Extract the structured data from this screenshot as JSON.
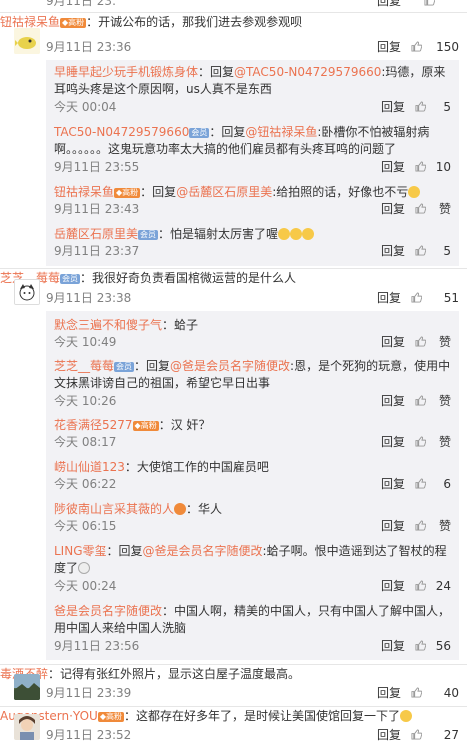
{
  "colors": {
    "name": "#eb7350",
    "vip": "#f08a3a",
    "member": "#7aa3d8",
    "reply_bg": "#f2f2f5"
  },
  "labels": {
    "reply": "回复",
    "like": "赞"
  },
  "top_cutoff": {
    "time": "9月11日 23:"
  },
  "threads": [
    {
      "author": "钮祜禄呆鱼",
      "text": "：开诚公布的话，那我们进去参观参观呗",
      "time": "9月11日 23:36",
      "likes": "150",
      "replies": [
        {
          "author": "早睡早起少玩手机锻炼身体",
          "body_pre": "：回复",
          "mention": "@TAC50-N04729579660",
          "body": ":玛德，原来耳鸣头疼是这个原因啊，us人真不是东西",
          "time": "今天 00:04",
          "likes": "5"
        },
        {
          "author": "TAC50-N04729579660",
          "body_pre": "：回复",
          "mention": "@钮祜禄呆鱼",
          "body": ":卧槽你不怕被辐射病啊。。。。。。这鬼玩意功率太大搞的他们雇员都有头疼耳鸣的问题了",
          "time": "9月11日 23:55",
          "likes": "10"
        },
        {
          "author": "钮祜禄呆鱼",
          "body_pre": "：回复",
          "mention": "@岳麓区石原里美",
          "body": ":给拍照的话，好像也不亏",
          "time": "9月11日 23:43",
          "likes": "赞"
        },
        {
          "author": "岳麓区石原里美",
          "body_pre": "：怕是辐射太厉害了喔",
          "mention": "",
          "body": "",
          "time": "9月11日 23:37",
          "likes": "5"
        }
      ]
    },
    {
      "author": "芝芝__莓莓",
      "text": "：我很好奇负责看国棺微运营的是什么人",
      "time": "9月11日 23:38",
      "likes": "51",
      "replies": [
        {
          "author": "默念三遍不和傻子气",
          "body_pre": "：蛤子",
          "mention": "",
          "body": "",
          "time": "今天 10:49",
          "likes": "赞"
        },
        {
          "author": "芝芝__莓莓",
          "body_pre": "：回复",
          "mention": "@爸是会员名字随便改",
          "body": ":恩，是个死狗的玩意，使用中文抹黑诽谤自己的祖国，希望它早日出事",
          "time": "今天 10:26",
          "likes": "赞"
        },
        {
          "author": "花香满径5277",
          "body_pre": "：汉 奸？",
          "mention": "",
          "body": "",
          "time": "今天 08:17",
          "likes": "赞"
        },
        {
          "author": "崂山仙道123",
          "body_pre": "：大使馆工作的中国雇员吧",
          "mention": "",
          "body": "",
          "time": "今天 06:22",
          "likes": "6"
        },
        {
          "author": "陟彼南山言采其薇的人",
          "body_pre": "：华人",
          "mention": "",
          "body": "",
          "time": "今天 06:15",
          "likes": "赞"
        },
        {
          "author": "LING零玺",
          "body_pre": "：回复",
          "mention": "@爸是会员名字随便改",
          "body": ":蛤子啊。恨中造谣到达了智杖的程度了",
          "time": "今天 00:24",
          "likes": "24"
        },
        {
          "author": "爸是会员名字随便改",
          "body_pre": "：中国人啊，精美的中国人，只有中国人了解中国人，用中国人来给中国人洗脑",
          "mention": "",
          "body": "",
          "time": "9月11日 23:56",
          "likes": "56"
        }
      ]
    },
    {
      "author": "毒酒不醉",
      "text": "：记得有张红外照片，显示这白屋子温度最高。",
      "time": "9月11日 23:39",
      "likes": "40",
      "replies": []
    },
    {
      "author": "Augenstern·YOU",
      "text": "：这都存在好多年了，是时候让美国使馆回复一下了",
      "time": "9月11日 23:52",
      "likes": "27",
      "replies": []
    }
  ]
}
